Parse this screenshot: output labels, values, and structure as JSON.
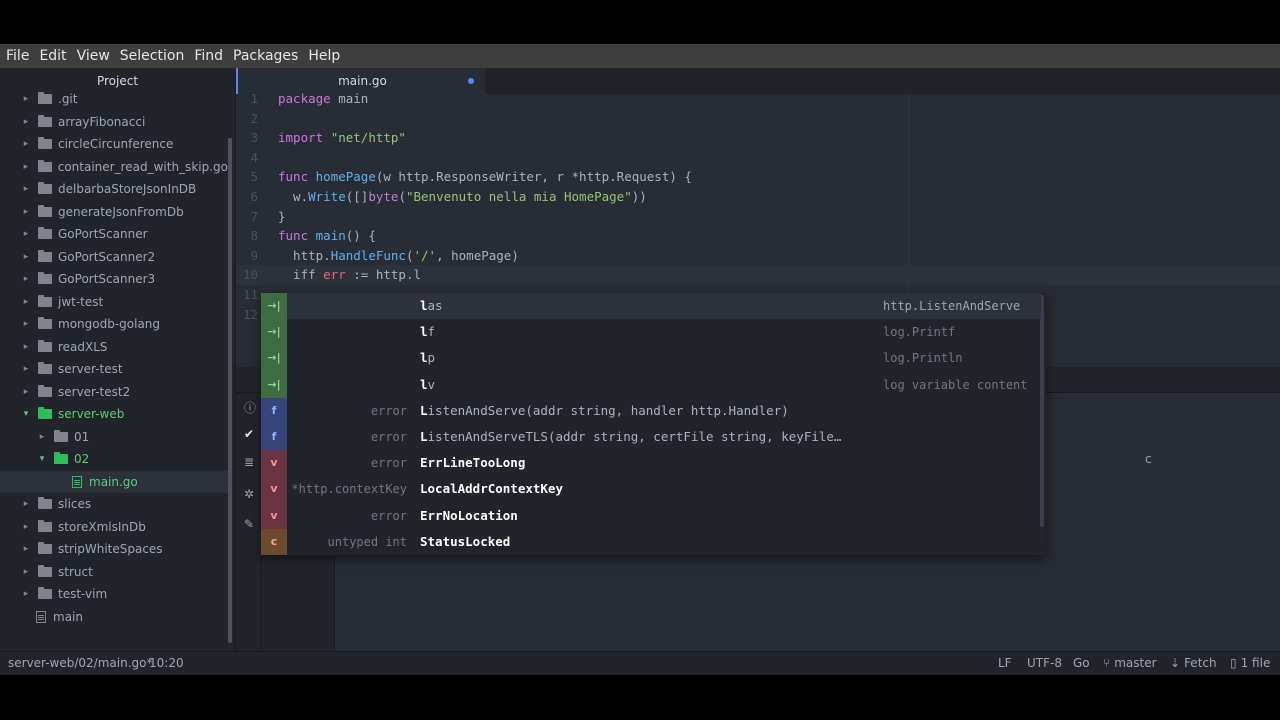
{
  "menu": [
    "File",
    "Edit",
    "View",
    "Selection",
    "Find",
    "Packages",
    "Help"
  ],
  "sidebar": {
    "title": "Project",
    "items": [
      {
        "label": ".git",
        "type": "folder",
        "depth": 0,
        "expanded": false
      },
      {
        "label": "arrayFibonacci",
        "type": "folder",
        "depth": 0,
        "expanded": false
      },
      {
        "label": "circleCircunference",
        "type": "folder",
        "depth": 0,
        "expanded": false
      },
      {
        "label": "container_read_with_skip.go",
        "type": "folder",
        "depth": 0,
        "expanded": false
      },
      {
        "label": "delbarbaStoreJsonInDB",
        "type": "folder",
        "depth": 0,
        "expanded": false
      },
      {
        "label": "generateJsonFromDb",
        "type": "folder",
        "depth": 0,
        "expanded": false
      },
      {
        "label": "GoPortScanner",
        "type": "folder",
        "depth": 0,
        "expanded": false
      },
      {
        "label": "GoPortScanner2",
        "type": "folder",
        "depth": 0,
        "expanded": false
      },
      {
        "label": "GoPortScanner3",
        "type": "folder",
        "depth": 0,
        "expanded": false
      },
      {
        "label": "jwt-test",
        "type": "folder",
        "depth": 0,
        "expanded": false
      },
      {
        "label": "mongodb-golang",
        "type": "folder",
        "depth": 0,
        "expanded": false
      },
      {
        "label": "readXLS",
        "type": "folder",
        "depth": 0,
        "expanded": false
      },
      {
        "label": "server-test",
        "type": "folder",
        "depth": 0,
        "expanded": false
      },
      {
        "label": "server-test2",
        "type": "folder",
        "depth": 0,
        "expanded": false
      },
      {
        "label": "server-web",
        "type": "folder",
        "depth": 0,
        "expanded": true
      },
      {
        "label": "01",
        "type": "folder",
        "depth": 1,
        "expanded": false
      },
      {
        "label": "02",
        "type": "folder",
        "depth": 1,
        "expanded": true
      },
      {
        "label": "main.go",
        "type": "file",
        "depth": 2,
        "selected": true
      },
      {
        "label": "slices",
        "type": "folder",
        "depth": 0,
        "expanded": false
      },
      {
        "label": "storeXmlsInDb",
        "type": "folder",
        "depth": 0,
        "expanded": false
      },
      {
        "label": "stripWhiteSpaces",
        "type": "folder",
        "depth": 0,
        "expanded": false
      },
      {
        "label": "struct",
        "type": "folder",
        "depth": 0,
        "expanded": false
      },
      {
        "label": "test-vim",
        "type": "folder",
        "depth": 0,
        "expanded": false
      },
      {
        "label": "main",
        "type": "file",
        "depth": 0
      }
    ]
  },
  "tab": {
    "title": "main.go",
    "modified": true
  },
  "editor": {
    "lines": [
      [
        [
          "kw",
          "package"
        ],
        [
          "plain",
          " main"
        ]
      ],
      [],
      [
        [
          "kw",
          "import"
        ],
        [
          "plain",
          " "
        ],
        [
          "str",
          "\"net/http\""
        ]
      ],
      [],
      [
        [
          "kw",
          "func"
        ],
        [
          "plain",
          " "
        ],
        [
          "fn",
          "homePage"
        ],
        [
          "plain",
          "(w http.ResponseWriter, r *http.Request) {"
        ]
      ],
      [
        [
          "plain",
          "  w."
        ],
        [
          "fn",
          "Write"
        ],
        [
          "plain",
          "([]"
        ],
        [
          "kw",
          "byte"
        ],
        [
          "plain",
          "("
        ],
        [
          "str",
          "\"Benvenuto nella mia HomePage\""
        ],
        [
          "plain",
          "))"
        ]
      ],
      [
        [
          "plain",
          "}"
        ]
      ],
      [
        [
          "kw",
          "func"
        ],
        [
          "plain",
          " "
        ],
        [
          "fn",
          "main"
        ],
        [
          "plain",
          "() {"
        ]
      ],
      [
        [
          "plain",
          "  http."
        ],
        [
          "fn",
          "HandleFunc"
        ],
        [
          "plain",
          "("
        ],
        [
          "str",
          "'/'"
        ],
        [
          "plain",
          ", homePage)"
        ]
      ],
      [
        [
          "plain",
          "  iff "
        ],
        [
          "var",
          "err"
        ],
        [
          "plain",
          " := http.l"
        ]
      ],
      [],
      []
    ],
    "cursor_line": 10
  },
  "autocomplete": {
    "items": [
      {
        "badge": "→|",
        "kind": "snippet",
        "left": "",
        "prefix": "l",
        "rest": "as",
        "right": "http.ListenAndServe",
        "selected": true
      },
      {
        "badge": "→|",
        "kind": "snippet",
        "left": "",
        "prefix": "l",
        "rest": "f",
        "right": "log.Printf"
      },
      {
        "badge": "→|",
        "kind": "snippet",
        "left": "",
        "prefix": "l",
        "rest": "p",
        "right": "log.Println"
      },
      {
        "badge": "→|",
        "kind": "snippet",
        "left": "",
        "prefix": "l",
        "rest": "v",
        "right": "log variable content"
      },
      {
        "badge": "f",
        "kind": "function",
        "left": "error",
        "prefix": "L",
        "rest": "istenAndServe(addr string, handler http.Handler)",
        "right": ""
      },
      {
        "badge": "f",
        "kind": "function",
        "left": "error",
        "prefix": "L",
        "rest": "istenAndServeTLS(addr string, certFile string, keyFile…",
        "right": ""
      },
      {
        "badge": "v",
        "kind": "variable",
        "left": "error",
        "prefix": "ErrLineTooLong",
        "rest": "",
        "right": ""
      },
      {
        "badge": "v",
        "kind": "variable",
        "left": "*http.contextKey",
        "prefix": "LocalAddrContextKey",
        "rest": "",
        "right": ""
      },
      {
        "badge": "v",
        "kind": "variable",
        "left": "error",
        "prefix": "ErrNoLocation",
        "rest": "",
        "right": ""
      },
      {
        "badge": "c",
        "kind": "constant",
        "left": "untyped int",
        "prefix": "StatusLocked",
        "rest": "",
        "right": ""
      }
    ]
  },
  "panel": {
    "fragment": "c"
  },
  "statusbar": {
    "file_path": "server-web/02/main.go*",
    "cursor": "10:20",
    "line_ending": "LF",
    "encoding": "UTF-8",
    "grammar": "Go",
    "branch": "master",
    "fetch": "Fetch",
    "files": "1 file"
  },
  "colors": {
    "accent": "#568af2",
    "snippet_badge": "#3f6b41",
    "function_badge": "#36457a",
    "variable_badge": "#6b3442",
    "constant_badge": "#6b4a2f"
  }
}
